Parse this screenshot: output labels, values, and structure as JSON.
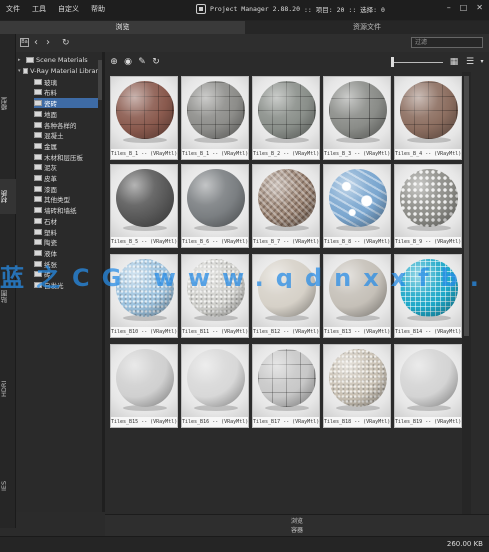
{
  "menu": [
    "文件",
    "工具",
    "自定义",
    "帮助"
  ],
  "app": {
    "title": "Project Manager 2.88.20",
    "project_count": ":: 项目: 20",
    "selected_count": ":: 选择: 0"
  },
  "window_controls": [
    "–",
    "□",
    "✕"
  ],
  "tabs": {
    "browse": "浏览",
    "resource_files": "资源文件"
  },
  "vtabs": [
    "模型",
    "材质",
    "贴图",
    "HDRI",
    "IES"
  ],
  "search": {
    "placeholder": "过滤"
  },
  "tree": {
    "items": [
      {
        "label": "Scene Materials",
        "level": 0,
        "expander": "▸",
        "selected": false
      },
      {
        "label": "V-Ray Material Library",
        "level": 0,
        "expander": "▾",
        "selected": false
      },
      {
        "label": "玻璃",
        "level": 1,
        "selected": false
      },
      {
        "label": "布料",
        "level": 1,
        "selected": false
      },
      {
        "label": "瓷砖",
        "level": 1,
        "selected": true
      },
      {
        "label": "地面",
        "level": 1,
        "selected": false
      },
      {
        "label": "各种各样的",
        "level": 1,
        "selected": false
      },
      {
        "label": "混凝土",
        "level": 1,
        "selected": false
      },
      {
        "label": "金属",
        "level": 1,
        "selected": false
      },
      {
        "label": "木材和层压板",
        "level": 1,
        "selected": false
      },
      {
        "label": "泥灰",
        "level": 1,
        "selected": false
      },
      {
        "label": "皮革",
        "level": 1,
        "selected": false
      },
      {
        "label": "漆面",
        "level": 1,
        "selected": false
      },
      {
        "label": "其他类型",
        "level": 1,
        "selected": false
      },
      {
        "label": "墙砖和墙纸",
        "level": 1,
        "selected": false
      },
      {
        "label": "石材",
        "level": 1,
        "selected": false
      },
      {
        "label": "塑料",
        "level": 1,
        "selected": false
      },
      {
        "label": "陶瓷",
        "level": 1,
        "selected": false
      },
      {
        "label": "液体",
        "level": 1,
        "selected": false
      },
      {
        "label": "纸张",
        "level": 1,
        "selected": false
      },
      {
        "label": "砖",
        "level": 1,
        "selected": false
      },
      {
        "label": "自发光",
        "level": 1,
        "selected": false
      }
    ]
  },
  "materials": [
    {
      "name": "Tiles_B_1 -- (VRayMtl)",
      "color": "#8a5a4e",
      "pattern": "grid"
    },
    {
      "name": "Tiles_B_1 -- (VRayMtl)",
      "color": "#8d8d8a",
      "pattern": "grid"
    },
    {
      "name": "Tiles_B_2 -- (VRayMtl)",
      "color": "#8a8f8a",
      "pattern": "grid"
    },
    {
      "name": "Tiles_B_3 -- (VRayMtl)",
      "color": "#8a8c88",
      "pattern": "puzzle"
    },
    {
      "name": "Tiles_B_4 -- (VRayMtl)",
      "color": "#8c6e60",
      "pattern": "grid"
    },
    {
      "name": "Tiles_B_5 -- (VRayMtl)",
      "color": "#5a5a5a",
      "pattern": "plain"
    },
    {
      "name": "Tiles_B_6 -- (VRayMtl)",
      "color": "#7b7f82",
      "pattern": "plain"
    },
    {
      "name": "Tiles_B_7 -- (VRayMtl)",
      "color": "#9a8474",
      "pattern": "lattice"
    },
    {
      "name": "Tiles_B_8 -- (VRayMtl)",
      "color": "#7aa6cf",
      "pattern": "floral"
    },
    {
      "name": "Tiles_B_9 -- (VRayMtl)",
      "color": "#8d8d88",
      "pattern": "dots"
    },
    {
      "name": "Tiles_B10 -- (VRayMtl)",
      "color": "#9cc2de",
      "pattern": "speckle"
    },
    {
      "name": "Tiles_B11 -- (VRayMtl)",
      "color": "#d0d0cc",
      "pattern": "speckle"
    },
    {
      "name": "Tiles_B12 -- (VRayMtl)",
      "color": "#d6d1c8",
      "pattern": "plain"
    },
    {
      "name": "Tiles_B13 -- (VRayMtl)",
      "color": "#c5c0b8",
      "pattern": "plain"
    },
    {
      "name": "Tiles_B14 -- (VRayMtl)",
      "color": "#1ea8c8",
      "pattern": "mosaic"
    },
    {
      "name": "Tiles_B15 -- (VRayMtl)",
      "color": "#d0d0d0",
      "pattern": "plain"
    },
    {
      "name": "Tiles_B16 -- (VRayMtl)",
      "color": "#d8d8d8",
      "pattern": "plain"
    },
    {
      "name": "Tiles_B17 -- (VRayMtl)",
      "color": "#c8c8c8",
      "pattern": "grid"
    },
    {
      "name": "Tiles_B18 -- (VRayMtl)",
      "color": "#c9c1b4",
      "pattern": "speckle"
    },
    {
      "name": "Tiles_B19 -- (VRayMtl)",
      "color": "#d4d4d4",
      "pattern": "plain"
    }
  ],
  "watermark": "蓝之CG www.qdnxxfb.c",
  "bottom": {
    "tab1": "浏览",
    "tab2": "容器"
  },
  "status": {
    "size": "260.00 KB"
  }
}
